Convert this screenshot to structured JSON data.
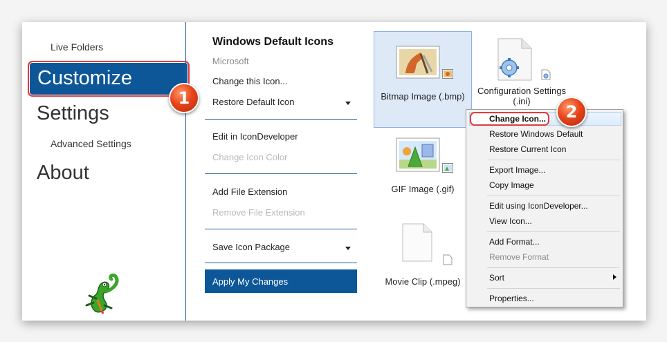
{
  "nav": {
    "live_folders": "Live Folders",
    "customize": "Customize",
    "settings": "Settings",
    "advanced_settings": "Advanced Settings",
    "about": "About"
  },
  "callouts": {
    "one": "1",
    "two": "2"
  },
  "package": {
    "title": "Windows Default Icons",
    "author": "Microsoft",
    "change_icon": "Change this Icon...",
    "restore_default": "Restore Default Icon",
    "edit_icondeveloper": "Edit in IconDeveloper",
    "change_icon_color": "Change Icon Color",
    "add_extension": "Add File Extension",
    "remove_extension": "Remove File Extension",
    "save_package": "Save Icon Package",
    "apply": "Apply My Changes"
  },
  "tiles": [
    {
      "label": "Bitmap Image (.bmp)",
      "icon": "bitmap-image-icon"
    },
    {
      "label": "Configuration Settings (.ini)",
      "icon": "configuration-settings-icon"
    },
    {
      "label": "GIF Image (.gif)",
      "icon": "gif-image-icon"
    },
    {
      "label": "Movie Clip (.mpeg)",
      "icon": "movie-clip-icon"
    }
  ],
  "context_menu": {
    "change_icon": "Change Icon...",
    "restore_windows_default": "Restore Windows Default",
    "restore_current_icon": "Restore Current Icon",
    "export_image": "Export Image...",
    "copy_image": "Copy Image",
    "edit_using": "Edit using IconDeveloper...",
    "view_icon": "View Icon...",
    "add_format": "Add Format...",
    "remove_format": "Remove Format",
    "sort": "Sort",
    "properties": "Properties..."
  },
  "colors": {
    "accent_blue": "#0d5799",
    "highlight_red": "#e23a3a",
    "badge_orange": "#e8451b"
  }
}
